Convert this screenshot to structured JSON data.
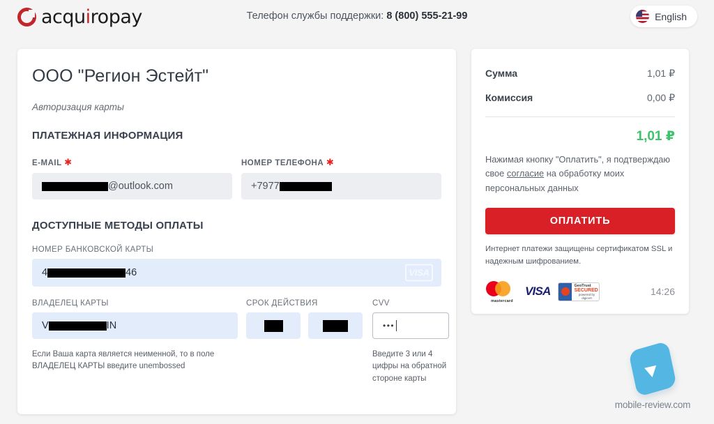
{
  "header": {
    "logo_text": "acquiropay",
    "logo_icon": "acquiropay-circle-logo",
    "support_prefix": "Телефон службы поддержки:",
    "support_phone": "8 (800) 555-21-99",
    "language_label": "English",
    "language_flag": "us-flag-icon"
  },
  "form": {
    "merchant": "ООО \"Регион Эстейт\"",
    "auth_note": "Авторизация карты",
    "payment_info_heading": "ПЛАТЕЖНАЯ ИНФОРМАЦИЯ",
    "email": {
      "label": "E-MAIL",
      "required_mark": "✱",
      "value_suffix": "@outlook.com",
      "value_redacted": true
    },
    "phone": {
      "label": "НОМЕР ТЕЛЕФОНА",
      "required_mark": "✱",
      "value_prefix": "+7977",
      "value_redacted": true
    },
    "methods_heading": "ДОСТУПНЫЕ МЕТОДЫ ОПЛАТЫ",
    "card_number": {
      "label": "НОМЕР БАНКОВСКОЙ КАРТЫ",
      "value_prefix": "4",
      "value_suffix": "46",
      "brand_badge": "VISA"
    },
    "card_holder": {
      "label": "ВЛАДЕЛЕЦ КАРТЫ",
      "value_prefix": "V",
      "value_suffix": "IN"
    },
    "expiry": {
      "label": "СРОК ДЕЙСТВИЯ",
      "month_value": "",
      "year_value": ""
    },
    "cvv": {
      "label": "CVV",
      "value": "•••"
    },
    "holder_helper": "Если Ваша карта является неименной, то в поле ВЛАДЕЛЕЦ КАРТЫ введите unembossed",
    "cvv_helper": "Введите 3 или 4 цифры на обратной стороне карты"
  },
  "summary": {
    "amount_label": "Сумма",
    "amount_value": "1,01 ₽",
    "fee_label": "Комиссия",
    "fee_value": "0,00 ₽",
    "total_value": "1,01 ₽",
    "total_color": "#3ec26b",
    "consent_part1": "Нажимая кнопку \"Оплатить\", я подтверждаю свое",
    "consent_link": "согласие",
    "consent_part2": "на обработку моих персональных данных",
    "pay_button": "ОПЛАТИТЬ",
    "pay_button_color": "#d92026",
    "ssl_note": "Интернет платежи защищены сертификатом SSL и надежным шифрованием.",
    "badges": {
      "mastercard": "mastercard",
      "visa": "VISA",
      "geotrust_line1": "GeoTrust",
      "geotrust_line2": "SECURED",
      "geotrust_footer": "powered by digicert"
    },
    "timer": "14:26"
  },
  "watermark": {
    "text": "mobile-review.com",
    "icon": "cursor-arrow-tile-icon"
  }
}
